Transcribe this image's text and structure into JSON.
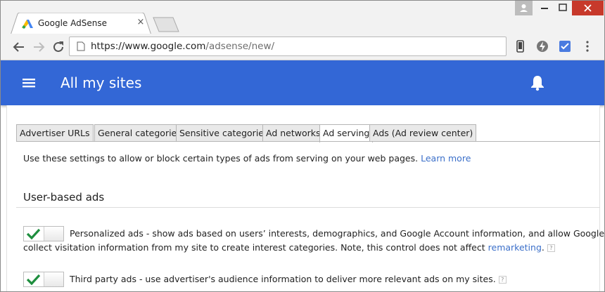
{
  "browser": {
    "tab_title": "Google AdSense",
    "tab_close": "×",
    "url_host": "https://www.google.com",
    "url_path": "/adsense/new/",
    "colors": {
      "chrome_bg": "#f2f2f2",
      "close_red": "#c7392b"
    },
    "toolbar_icons": [
      "back-icon",
      "forward-icon",
      "reload-icon",
      "page-icon",
      "phone-icon",
      "bolt-icon",
      "check-extension-icon",
      "kebab-menu-icon"
    ]
  },
  "app": {
    "title": "All my sites",
    "accent": "#3367d6",
    "icons": [
      "hamburger-menu-icon",
      "bell-icon"
    ]
  },
  "tabs": [
    {
      "label": "Advertiser URLs",
      "active": false
    },
    {
      "label": "General categories",
      "active": false
    },
    {
      "label": "Sensitive categories",
      "active": false
    },
    {
      "label": "Ad networks",
      "active": false
    },
    {
      "label": "Ad serving",
      "active": true
    },
    {
      "label": "Ads (Ad review center)",
      "active": false
    }
  ],
  "intro": {
    "text": "Use these settings to allow or block certain types of ads from serving on your web pages.",
    "link": "Learn more"
  },
  "section": {
    "title": "User-based ads",
    "settings": [
      {
        "enabled": true,
        "line1": "Personalized ads - show ads based on users’ interests, demographics, and Google Account information, and allow Google to",
        "line2": "collect visitation information from my site to create interest categories. Note, this control does not affect",
        "link": "remarketing",
        "help": "?"
      },
      {
        "enabled": true,
        "line1": "Third party ads - use advertiser's audience information to deliver more relevant ads on my sites.",
        "help": "?"
      }
    ]
  }
}
